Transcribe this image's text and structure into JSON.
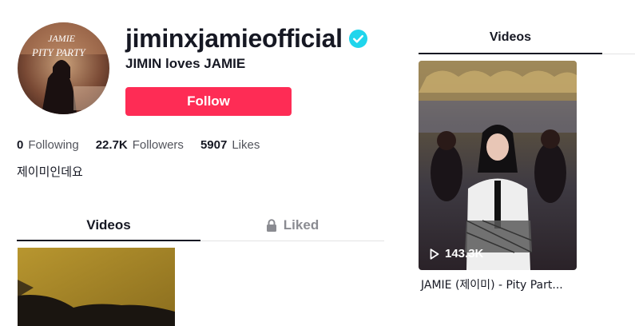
{
  "profile": {
    "username": "jiminxjamieofficial",
    "nickname": "JIMIN loves JAMIE",
    "follow_label": "Follow",
    "bio": "제이미인데요",
    "avatar_text": [
      "JAMIE",
      "PITY PARTY"
    ]
  },
  "stats": [
    {
      "number": "0",
      "label": "Following"
    },
    {
      "number": "22.7K",
      "label": "Followers"
    },
    {
      "number": "5907",
      "label": "Likes"
    }
  ],
  "tabs": {
    "videos_label": "Videos",
    "liked_label": "Liked"
  },
  "sidebar": {
    "tab_label": "Videos",
    "video": {
      "views": "143.3K",
      "title": "JAMIE (제이미) - Pity Part..."
    }
  },
  "colors": {
    "follow": "#fe2c55",
    "verified": "#20d5ec",
    "text": "#161823"
  }
}
